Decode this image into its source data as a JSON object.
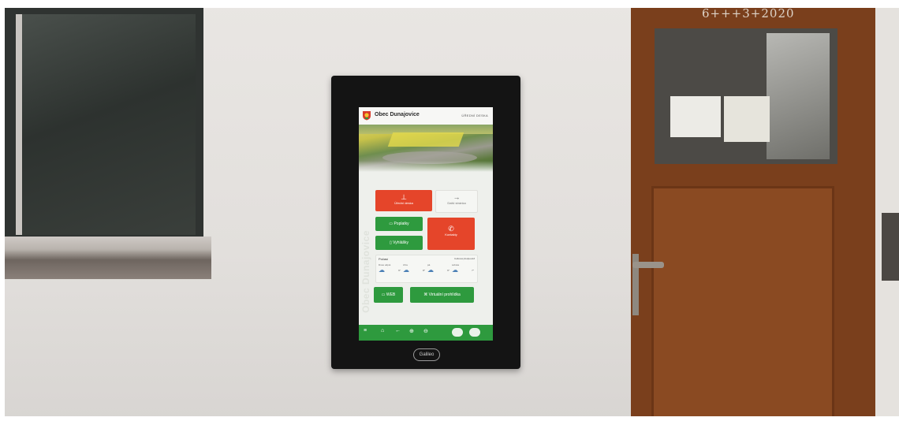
{
  "scene": {
    "door_chalk": "6+++3+2020"
  },
  "kiosk": {
    "brand": "Galileo",
    "header": {
      "title": "Obec Dunajovice",
      "subtitle": "ÚŘEDNÍ DESKA"
    },
    "side_text": "Obec Dunajovice",
    "tiles": {
      "uredni_deska": "Úřední deska",
      "dalsi": "Další stránka",
      "poplatky": "Poplatky",
      "vyhlasky": "Vyhlášky",
      "kontakty": "Kontakty",
      "web": "WEB",
      "prohlidka": "Virtuální prohlídka"
    },
    "weather": {
      "title": "Počasí",
      "link": "Celková předpověď",
      "days": [
        {
          "label": "Dnes odpol.",
          "temp": "9°"
        },
        {
          "label": "zítra",
          "temp": "8°"
        },
        {
          "label": "pá",
          "temp": "9°"
        },
        {
          "label": "sobota",
          "temp": "7°"
        }
      ]
    },
    "toolbar_icons": [
      "menu-icon",
      "home-icon",
      "back-icon",
      "zoom-in-icon",
      "zoom-out-icon",
      "contrast-icon",
      "accessibility-icon"
    ],
    "colors": {
      "green": "#2e9a3e",
      "red": "#e5452a"
    }
  }
}
